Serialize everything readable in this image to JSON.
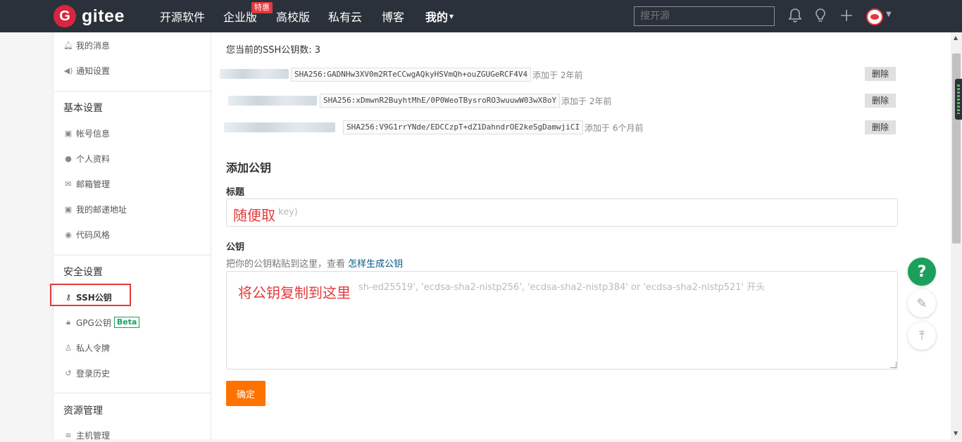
{
  "header": {
    "logo_mark": "G",
    "logo_text": "gitee",
    "nav": [
      "开源软件",
      "企业版",
      "高校版",
      "私有云",
      "博客",
      "我的"
    ],
    "nav_hot_badge": "特惠",
    "search_placeholder": "搜开源",
    "my_caret": "▾"
  },
  "sidebar": {
    "top_items": [
      {
        "icon": "bell-icon",
        "label": "我的消息"
      },
      {
        "icon": "speaker-icon",
        "label": "通知设置"
      }
    ],
    "sections": [
      {
        "title": "基本设置",
        "items": [
          {
            "icon": "id-card-icon",
            "label": "帐号信息"
          },
          {
            "icon": "user-icon",
            "label": "个人资料"
          },
          {
            "icon": "mail-icon",
            "label": "邮箱管理"
          },
          {
            "icon": "address-card-icon",
            "label": "我的邮递地址"
          },
          {
            "icon": "palette-icon",
            "label": "代码风格"
          }
        ]
      },
      {
        "title": "安全设置",
        "items": [
          {
            "icon": "key-icon",
            "label": "SSH公钥",
            "active": true
          },
          {
            "icon": "lock-icon",
            "label": "GPG公钥",
            "badge": "Beta"
          },
          {
            "icon": "token-icon",
            "label": "私人令牌"
          },
          {
            "icon": "history-icon",
            "label": "登录历史"
          }
        ]
      },
      {
        "title": "资源管理",
        "items": [
          {
            "icon": "server-icon",
            "label": "主机管理"
          }
        ]
      }
    ]
  },
  "main": {
    "key_count_text": "您当前的SSH公钥数: 3",
    "keys": [
      {
        "fingerprint": "SHA256:GADNHw3XV0m2RTeCCwgAQkyHSVmQh+ouZGUGeRCF4V4",
        "added": "添加于 2年前",
        "delete_label": "删除"
      },
      {
        "fingerprint": "SHA256:xDmwnR2BuyhtMhE/0P0WeoTBysroRO3wuuwW03wX8oY",
        "added": "添加于 2年前",
        "delete_label": "删除"
      },
      {
        "fingerprint": "SHA256:V9G1rrYNde/EDCCzpT+dZ1DahndrOE2keSgDamwjiCI",
        "added": "添加于 6个月前",
        "delete_label": "删除"
      }
    ],
    "add_title": "添加公钥",
    "title_label": "标题",
    "title_placeholder": "key)",
    "title_overlay": "随便取",
    "pubkey_label": "公钥",
    "pubkey_hint": "把你的公钥粘贴到这里，查看",
    "pubkey_hint_link": "怎样生成公钥",
    "pubkey_placeholder": "sh-ed25519', 'ecdsa-sha2-nistp256', 'ecdsa-sha2-nistp384' or 'ecdsa-sha2-nistp521' 开头",
    "pubkey_overlay": "将公钥复制到这里",
    "submit_label": "确定"
  },
  "float": {
    "help": "?",
    "feedback": "✎",
    "top": "⤒"
  },
  "colors": {
    "brand": "#d7263d",
    "header_bg": "#2b313a",
    "submit": "#fe7300",
    "help": "#1aa05a",
    "annotation": "#e4393c"
  }
}
